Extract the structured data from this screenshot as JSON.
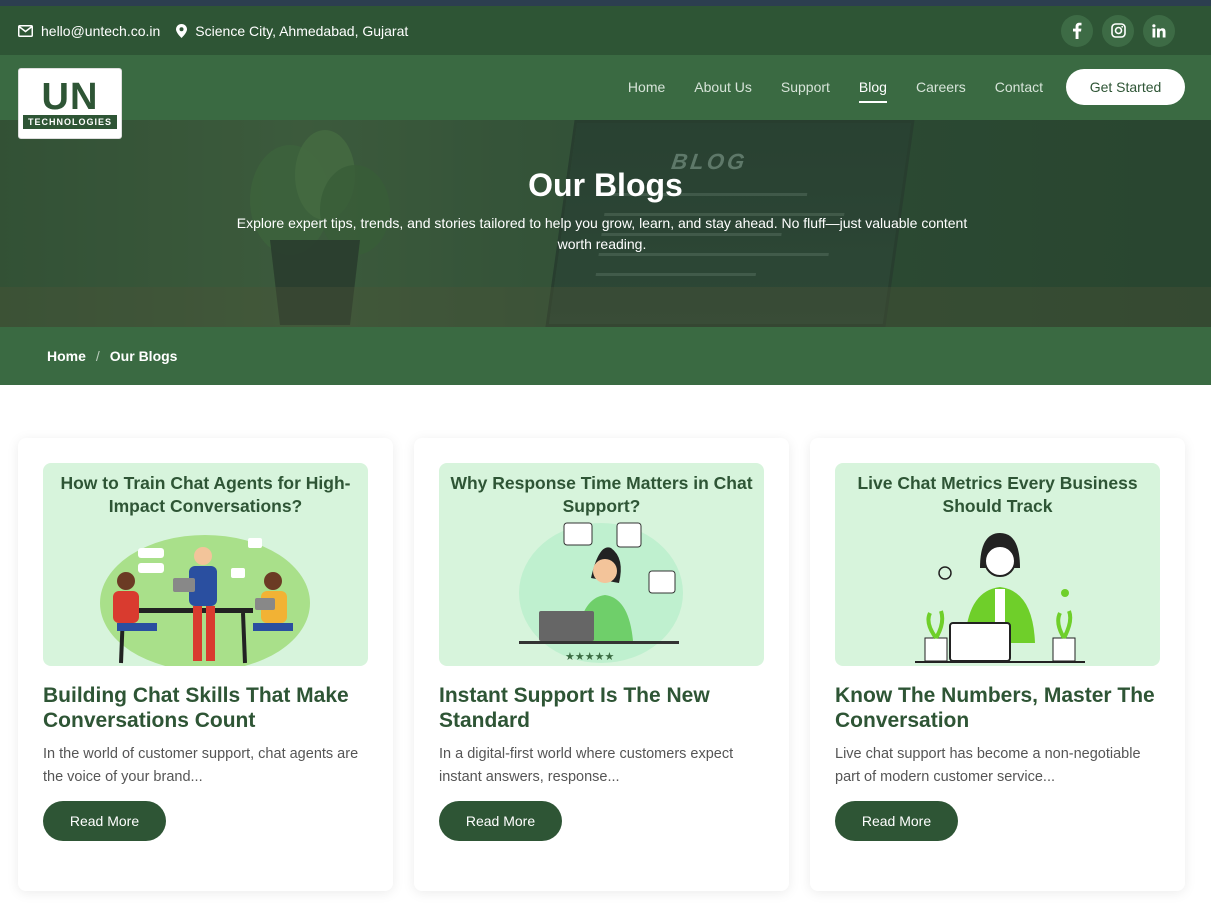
{
  "topbar": {
    "email": "hello@untech.co.in",
    "location": "Science City, Ahmedabad, Gujarat",
    "socials": [
      "f",
      "ig",
      "in"
    ]
  },
  "logo": {
    "mark": "UN",
    "sub": "TECHNOLOGIES"
  },
  "nav": {
    "items": [
      {
        "label": "Home"
      },
      {
        "label": "About Us"
      },
      {
        "label": "Support"
      },
      {
        "label": "Blog"
      },
      {
        "label": "Careers"
      },
      {
        "label": "Contact"
      }
    ],
    "active": "Blog",
    "cta": "Get Started"
  },
  "hero": {
    "bg_word": "BLOG",
    "title": "Our Blogs",
    "subtitle": "Explore expert tips, trends, and stories tailored to help you grow, learn, and stay ahead. No fluff—just valuable content worth reading."
  },
  "breadcrumb": {
    "home": "Home",
    "sep": "/",
    "current": "Our Blogs"
  },
  "cards": [
    {
      "image_title": "How to Train Chat Agents for High-Impact Conversations?",
      "title": "Building Chat Skills That Make Conversations Count",
      "excerpt": "In the world of customer support, chat agents are the voice of your brand...",
      "button": "Read More"
    },
    {
      "image_title": "Why Response Time Matters in Chat Support?",
      "title": "Instant Support Is The New Standard",
      "excerpt": "In a digital-first world where customers expect instant answers, response...",
      "button": "Read More"
    },
    {
      "image_title": "Live Chat Metrics Every Business Should Track",
      "title": "Know The Numbers, Master The Conversation",
      "excerpt": "Live chat support has become a non-negotiable part of modern customer service...",
      "button": "Read More"
    }
  ],
  "colors": {
    "brand_dark": "#2e5535",
    "brand": "#3a6a42",
    "thumb_bg": "#d7f4dc"
  }
}
